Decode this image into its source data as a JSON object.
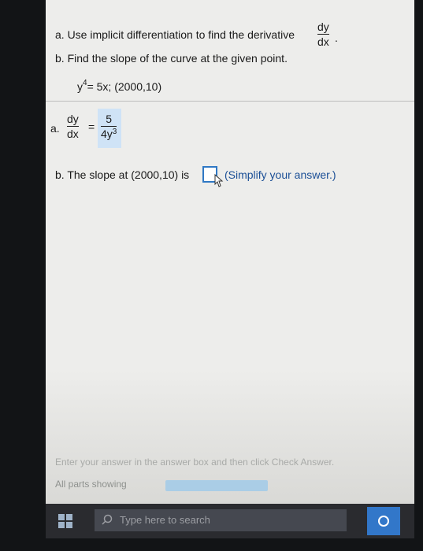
{
  "question": {
    "part_a_text": "a. Use implicit differentiation to find the derivative",
    "deriv_num": "dy",
    "deriv_den": "dx",
    "part_a_end": ".",
    "part_b_text": "b. Find the slope of the curve at the given point.",
    "equation_base": "y",
    "equation_exp": "4",
    "equation_rest": "= 5x; (2000,10)"
  },
  "answer_a": {
    "label": "a.",
    "lhs_num": "dy",
    "lhs_den": "dx",
    "equals": "=",
    "rhs_num": "5",
    "rhs_den_base": "4y",
    "rhs_den_exp": "3"
  },
  "answer_b": {
    "prefix": "b. The slope at (2000,10) is",
    "value": "",
    "hint": "(Simplify your answer.)"
  },
  "footer": {
    "instruction": "Enter your answer in the answer box and then click Check Answer.",
    "parts_label": "All parts showing",
    "progress": 1.0
  },
  "taskbar": {
    "search_placeholder": "Type here to search",
    "accent": "#3277c9"
  }
}
